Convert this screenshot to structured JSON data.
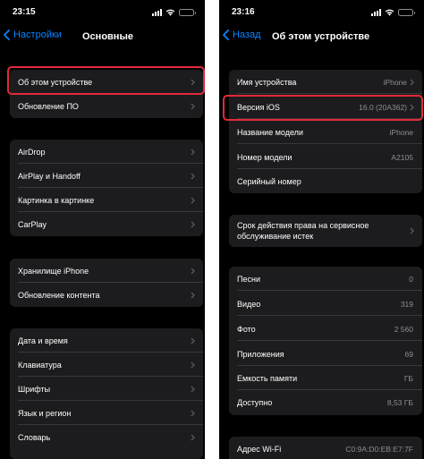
{
  "colors": {
    "accent": "#0a84ff",
    "highlight": "#e2293a",
    "background": "#000000",
    "cell": "#1c1c1e",
    "secondary_text": "#8e8e93"
  },
  "left": {
    "status": {
      "time": "23:15"
    },
    "nav": {
      "back_label": "Настройки",
      "title": "Основные"
    },
    "groups": [
      {
        "items": [
          {
            "label": "Об этом устройстве",
            "icon": "chevron-right-icon"
          },
          {
            "label": "Обновление ПО",
            "icon": "chevron-right-icon"
          }
        ]
      },
      {
        "items": [
          {
            "label": "AirDrop"
          },
          {
            "label": "AirPlay и Handoff"
          },
          {
            "label": "Картинка в картинке"
          },
          {
            "label": "CarPlay"
          }
        ]
      },
      {
        "items": [
          {
            "label": "Хранилище iPhone"
          },
          {
            "label": "Обновление контента"
          }
        ]
      },
      {
        "items": [
          {
            "label": "Дата и время"
          },
          {
            "label": "Клавиатура"
          },
          {
            "label": "Шрифты"
          },
          {
            "label": "Язык и регион"
          },
          {
            "label": "Словарь"
          }
        ]
      }
    ]
  },
  "right": {
    "status": {
      "time": "23:16"
    },
    "nav": {
      "back_label": "Назад",
      "title": "Об этом устройстве"
    },
    "groups": [
      {
        "items": [
          {
            "label": "Имя устройства",
            "value": "iPhone"
          },
          {
            "label": "Версия iOS",
            "value": "16.0 (20A362)"
          },
          {
            "label": "Название модели",
            "value": "iPhone"
          },
          {
            "label": "Номер модели",
            "value": "A2105"
          },
          {
            "label": "Серийный номер",
            "value": ""
          }
        ]
      },
      {
        "items": [
          {
            "label": "Срок действия права на сервисное обслуживание истек"
          }
        ]
      },
      {
        "items": [
          {
            "label": "Песни",
            "value": "0"
          },
          {
            "label": "Видео",
            "value": "319"
          },
          {
            "label": "Фото",
            "value": "2 560"
          },
          {
            "label": "Приложения",
            "value": "69"
          },
          {
            "label": "Емкость памяти",
            "value": "ГБ"
          },
          {
            "label": "Доступно",
            "value": "8,53 ГБ"
          }
        ]
      },
      {
        "items": [
          {
            "label": "Адрес Wi-Fi",
            "value": "C0:9A:D0:EB:E7:7F"
          }
        ]
      }
    ]
  }
}
